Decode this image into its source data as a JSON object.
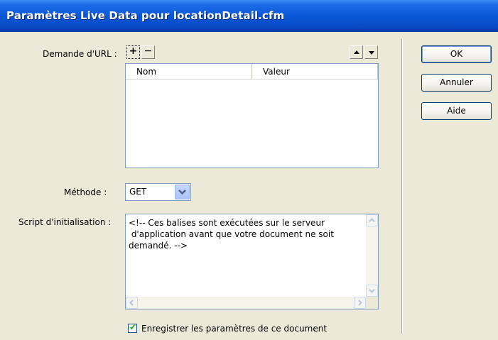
{
  "window": {
    "title": "Paramètres Live Data pour locationDetail.cfm"
  },
  "url_request": {
    "label": "Demande d'URL :",
    "add_label": "+",
    "remove_label": "−",
    "columns": [
      "Nom",
      "Valeur"
    ],
    "rows": []
  },
  "method": {
    "label": "Méthode :",
    "value": "GET"
  },
  "init_script": {
    "label": "Script d'initialisation :",
    "text": "<!-- Ces balises sont exécutées sur le serveur\n d'application avant que votre document ne soit\ndemandé. -->"
  },
  "save_option": {
    "label": "Enregistrer les paramètres de ce document",
    "checked": true
  },
  "buttons": {
    "ok": "OK",
    "cancel": "Annuler",
    "help": "Aide"
  },
  "colors": {
    "title_bar": "#0a58d8",
    "dialog_bg": "#ece9d8",
    "field_border": "#7f9db9",
    "check_green": "#21a121"
  }
}
